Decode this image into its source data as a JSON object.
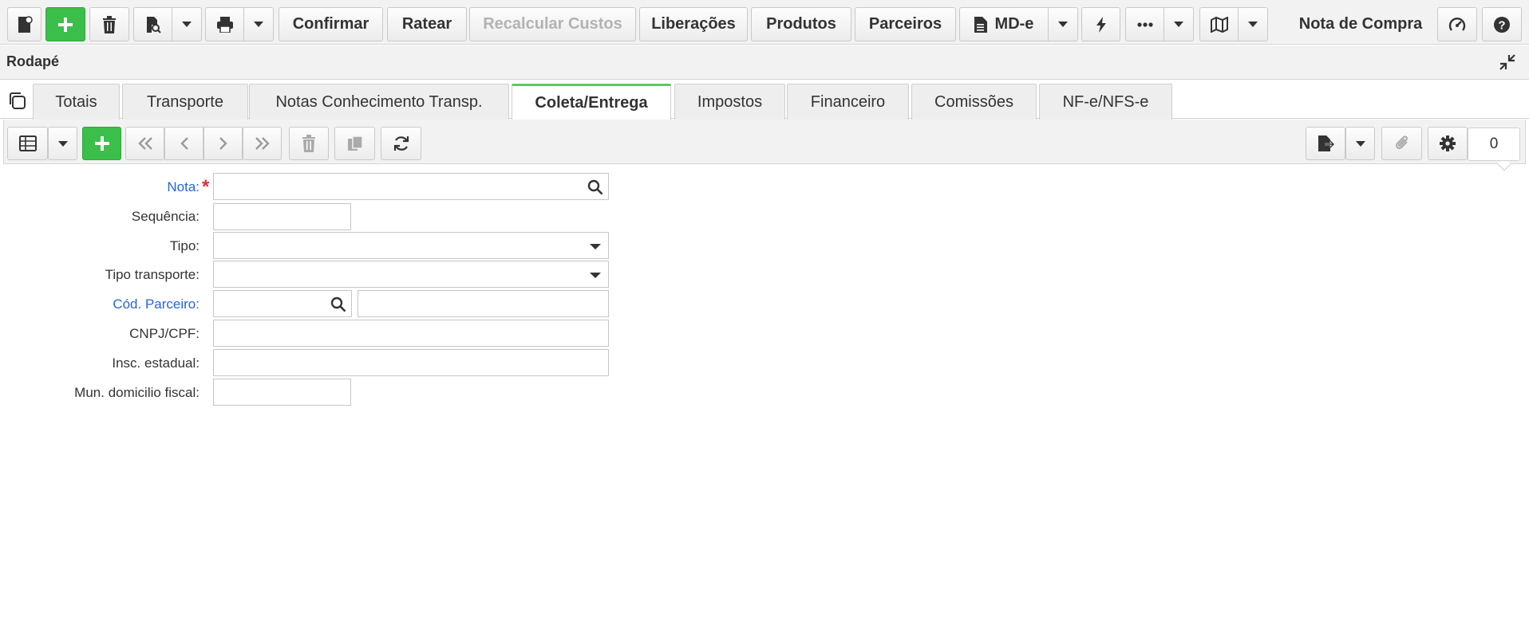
{
  "toolbar": {
    "confirm_label": "Confirmar",
    "rateio_label": "Ratear",
    "recalc_label": "Recalcular Custos",
    "liberacoes_label": "Liberações",
    "produtos_label": "Produtos",
    "parceiros_label": "Parceiros",
    "mde_label": "MD-e",
    "title": "Nota de Compra"
  },
  "section": {
    "title": "Rodapé"
  },
  "tabs": [
    {
      "label": "Totais"
    },
    {
      "label": "Transporte"
    },
    {
      "label": "Notas Conhecimento Transp."
    },
    {
      "label": "Coleta/Entrega",
      "active": true
    },
    {
      "label": "Impostos"
    },
    {
      "label": "Financeiro"
    },
    {
      "label": "Comissões"
    },
    {
      "label": "NF-e/NFS-e"
    }
  ],
  "grid": {
    "record_count": "0"
  },
  "form": {
    "nota": {
      "label": "Nota:",
      "value": ""
    },
    "sequencia": {
      "label": "Sequência:",
      "value": ""
    },
    "tipo": {
      "label": "Tipo:",
      "value": ""
    },
    "tipo_transporte": {
      "label": "Tipo transporte:",
      "value": ""
    },
    "cod_parceiro": {
      "label": "Cód. Parceiro:",
      "value": "",
      "name_value": ""
    },
    "cnpj_cpf": {
      "label": "CNPJ/CPF:",
      "value": ""
    },
    "insc_estadual": {
      "label": "Insc. estadual:",
      "value": ""
    },
    "mun_domicilio": {
      "label": "Mun. domicilio fiscal:",
      "value": ""
    }
  },
  "colors": {
    "accent_green": "#3bbf4a",
    "tab_active_border": "#5cc95f",
    "link_blue": "#2466d6",
    "required_red": "#dd3333"
  },
  "icons": [
    "new-document-icon",
    "plus-icon",
    "trash-icon",
    "search-document-icon",
    "printer-icon",
    "file-icon",
    "lightning-icon",
    "ellipsis-icon",
    "map-icon",
    "dashboard-icon",
    "help-icon",
    "collapse-icon",
    "copy-icon",
    "grid-icon",
    "first-icon",
    "prev-icon",
    "next-icon",
    "last-icon",
    "duplicate-icon",
    "refresh-icon",
    "export-icon",
    "attach-icon",
    "gear-icon",
    "search-icon"
  ]
}
